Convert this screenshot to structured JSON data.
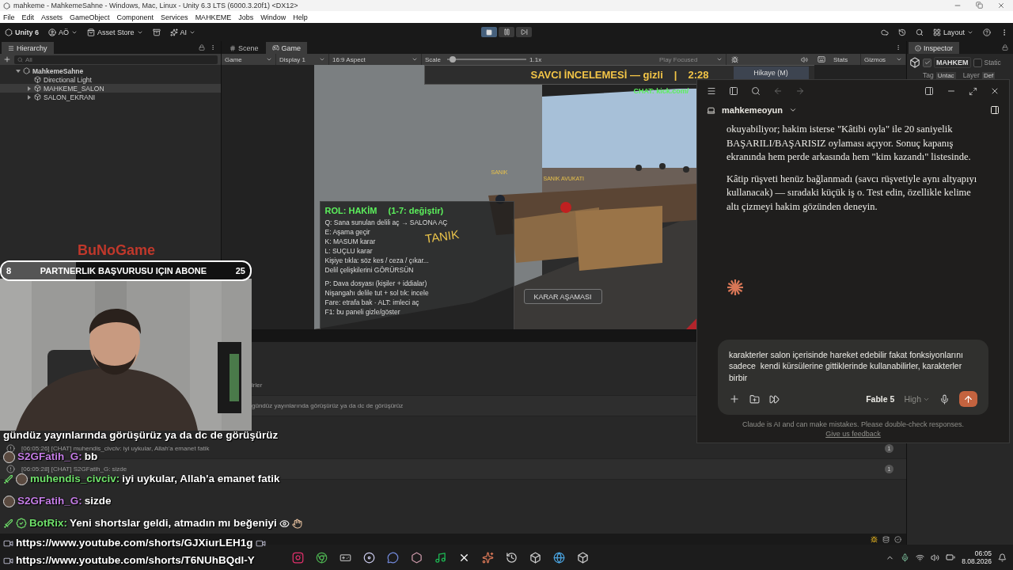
{
  "window": {
    "title": "mahkeme - MahkemeSahne - Windows, Mac, Linux - Unity 6.3 LTS (6000.3.20f1) <DX12>"
  },
  "menu": [
    "File",
    "Edit",
    "Assets",
    "GameObject",
    "Component",
    "Services",
    "MAHKEME",
    "Jobs",
    "Window",
    "Help"
  ],
  "toolbar": {
    "product": "Unity 6",
    "account": "AÖ",
    "asset_store": "Asset Store",
    "ai": "AI",
    "layout": "Layout"
  },
  "playback": [
    {
      "kind": "stop",
      "selected": true
    },
    {
      "kind": "pause",
      "selected": false
    },
    {
      "kind": "step",
      "selected": false
    }
  ],
  "hierarchy": {
    "title": "Hierarchy",
    "search_placeholder": "All",
    "tree": [
      {
        "label": "MahkemeSahne",
        "kind": "scene",
        "expanded": true,
        "selected": false,
        "children": [
          {
            "label": "Directional Light",
            "kind": "object",
            "selected": false
          },
          {
            "label": "MAHKEME_SALON",
            "kind": "object",
            "expanded": false,
            "selected": true
          },
          {
            "label": "SALON_EKRANI",
            "kind": "object",
            "expanded": false,
            "selected": false
          }
        ]
      }
    ]
  },
  "center_tabs": [
    {
      "label": "Scene",
      "kind": "scene",
      "selected": false
    },
    {
      "label": "Game",
      "kind": "game",
      "selected": true
    }
  ],
  "game_toolbar": {
    "view": "Game",
    "display": "Display 1",
    "aspect": "16:9 Aspect",
    "scale_label": "Scale",
    "scale": {
      "level": 0.03
    },
    "scale_reading": "1.1x",
    "play_mode": "Play Focused",
    "stats": "Stats",
    "gizmos": "Gizmos"
  },
  "game_view": {
    "hud_title": "SAVCI İNCELEMESİ — gizli",
    "separator": "|",
    "timer": "2:28",
    "story_button": "Hikaye (M)",
    "chat_hint": "CHAT: kick.com/",
    "tanik": "TANIK",
    "sanik": "SANIK",
    "sanik_avukati": "SANIK AVUKATI",
    "role": "ROL: HAKİM",
    "role_hint": "(1-7: değiştir)",
    "role_lines": [
      "Q: Sana sunulan delili aç → SALONA AÇ",
      "E: Aşama geçir",
      "K: MASUM karar",
      "L: SUÇLU karar",
      "Kişiye tıkla: söz kes / ceza / çıkar...",
      "Delil çelişkilerini GÖRÜRSÜN"
    ],
    "help_lines": [
      "P: Dava dosyası (kişiler + iddialar)",
      "Nişangahı delile tut + sol tık: incele",
      "Fare: etrafa bak  ·  ALT: imleci aç",
      "F1: bu paneli gizle/göster"
    ],
    "phase_button": "KARAR AŞAMASI"
  },
  "inspector": {
    "title": "Inspector",
    "active": true,
    "object_name": "MAHKEM",
    "static": false,
    "static_label": "Static",
    "tag_label": "Tag",
    "tag_value": "Untac",
    "layer_label": "Layer",
    "layer_value": "Def"
  },
  "console": {
    "fragments": [
      "irler",
      "gündüz yayınlarında görüşürüz ya da dc de görüşürüz"
    ],
    "entries": [
      {
        "text": "[06:05:26] [CHAT] muhendis_civciv: iyi uykular, Allah'a emanet fatik",
        "count": "1"
      },
      {
        "text": "[06:05:28] [CHAT] S2GFatih_G: sizde",
        "count": "1"
      }
    ]
  },
  "claude": {
    "project": "mahkemeoyun",
    "paragraphs": [
      "okuyabiliyor; hakim isterse \"Kâtibi oyla\" ile 20 saniyelik BAŞARILI/BAŞARISIZ oylaması açıyor. Sonuç kapanış ekranında hem perde arkasında hem \"kim kazandı\" listesinde.",
      "Kâtip rüşveti henüz bağlanmadı (savcı rüşvetiyle aynı altyapıyı kullanacak) — sıradaki küçük iş o. Test edin, özellikle kelime altı çizmeyi hakim gözünden deneyin."
    ],
    "input_value": "karakterler salon içerisinde hareket edebilir fakat fonksiyonlarını sadece  kendi kürsülerine gittiklerinde kullanabilirler, karakterler birbir",
    "model": "Fable 5",
    "effort": "High",
    "disclaimer": "Claude is AI and can make mistakes. Please double-check responses.",
    "feedback": "Give us feedback"
  },
  "banner": {
    "logo": "BuNoGame",
    "current": "8",
    "text": "PARTNERLIK BAŞVURUSU IÇIN ABONE",
    "goal": "25",
    "level": 0.3
  },
  "chat_overlay": [
    {
      "kind": "plain",
      "text": "gündüz yayınlarında görüşürüz ya da dc de görüşürüz"
    },
    {
      "kind": "message",
      "user": "S2GFatih_G:",
      "color": "#c57de6",
      "mod": false,
      "verified": false,
      "text": "bb"
    },
    {
      "kind": "message",
      "user": "muhendis_civciv:",
      "color": "#6fe06a",
      "mod": true,
      "verified": false,
      "text": "iyi uykular, Allah'a emanet fatik"
    },
    {
      "kind": "message",
      "user": "S2GFatih_G:",
      "color": "#c57de6",
      "mod": false,
      "verified": false,
      "text": "sizde"
    },
    {
      "kind": "message",
      "user": "BotRix:",
      "color": "#6fe06a",
      "mod": true,
      "verified": true,
      "text": "Yeni shortslar geldi, atmadın mı beğeniyi"
    },
    {
      "kind": "link",
      "text": "https://www.youtube.com/shorts/GJXiurLEH1g"
    },
    {
      "kind": "link",
      "text": "https://www.youtube.com/shorts/T6NUhBQdl-Y"
    }
  ],
  "taskbar": {
    "time": "06:05",
    "date": "8.08.2026"
  }
}
